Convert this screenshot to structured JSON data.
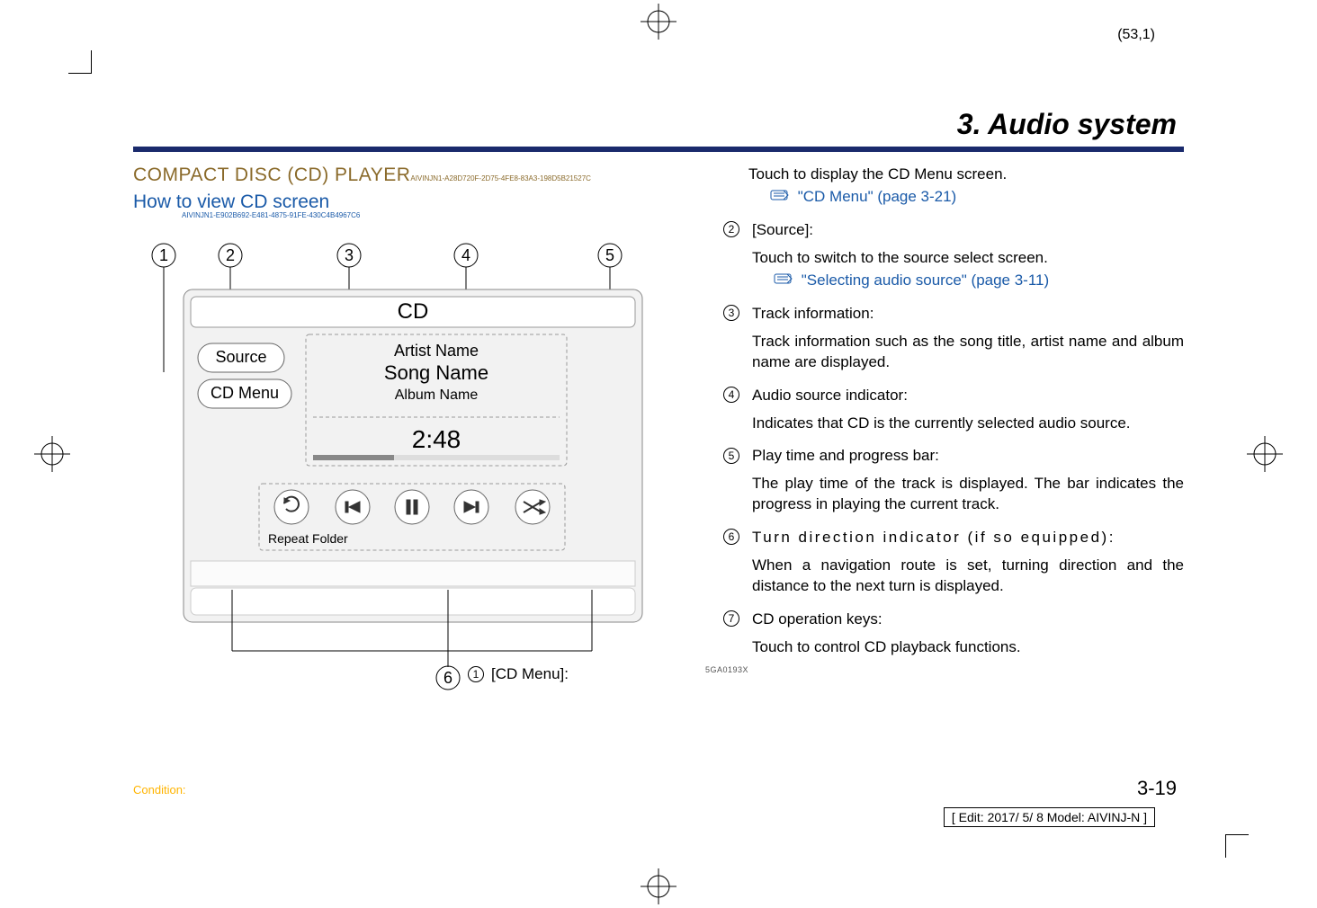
{
  "sheet_coord": "(53,1)",
  "chapter_title": "3. Audio system",
  "section_title": "COMPACT DISC (CD) PLAYER",
  "section_guid": "AIVINJN1-A28D720F-2D75-4FE8-83A3-198D5B21527C",
  "subsection_title": "How to view CD screen",
  "subsection_guid": "AIVINJN1-E902B692-E481-4875-91FE-430C4B4967C6",
  "figure": {
    "title_bar": "CD",
    "source_btn": "Source",
    "cdmenu_btn": "CD Menu",
    "artist": "Artist Name",
    "song": "Song Name",
    "album": "Album Name",
    "time": "2:48",
    "repeat_label": "Repeat Folder",
    "code": "5GA0193X"
  },
  "callout_bottom": {
    "num": "①",
    "label": "[CD Menu]:"
  },
  "right_lead": {
    "desc": "Touch to display the CD Menu screen.",
    "see": "\"CD Menu\" (page 3-21)"
  },
  "items": [
    {
      "num": "②",
      "label": "[Source]:",
      "desc": "Touch to switch to the source select screen.",
      "see": "\"Selecting audio source\" (page 3-11)"
    },
    {
      "num": "③",
      "label": "Track information:",
      "desc": "Track information such as the song title, artist name and album name are displayed."
    },
    {
      "num": "④",
      "label": "Audio source indicator:",
      "desc": "Indicates that CD is the currently selected audio source."
    },
    {
      "num": "⑤",
      "label": "Play time and progress bar:",
      "desc": "The play time of the track is displayed. The bar indicates the progress in playing the current track."
    },
    {
      "num": "⑥",
      "label": "Turn direction indicator (if so equipped):",
      "desc": "When a navigation route is set, turning direction and the distance to the next turn is displayed."
    },
    {
      "num": "⑦",
      "label": "CD operation keys:",
      "desc": "Touch to control CD playback functions."
    }
  ],
  "page_number": "3-19",
  "condition": "Condition:",
  "edit_box": "[ Edit: 2017/ 5/ 8   Model:  AIVINJ-N ]"
}
